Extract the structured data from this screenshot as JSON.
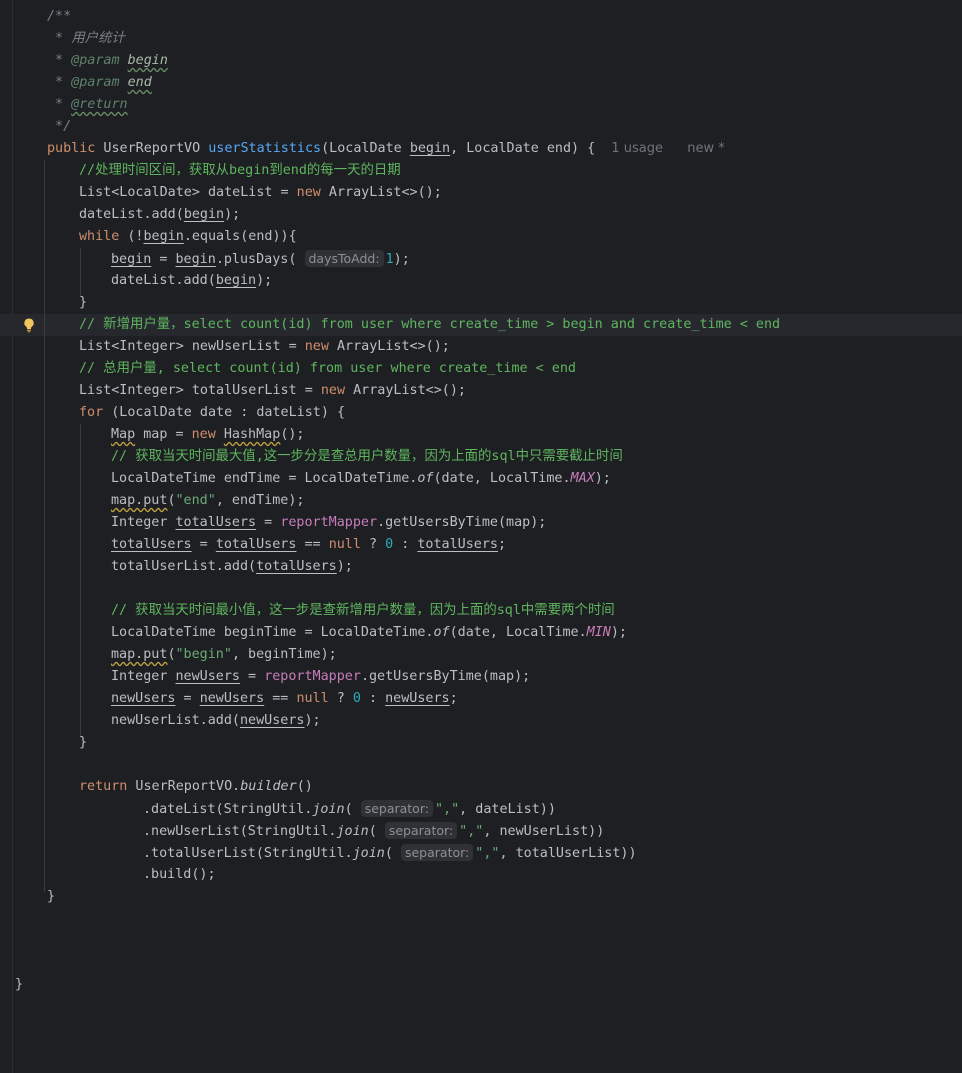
{
  "editor": {
    "doc": {
      "open": "/**",
      "desc_prefix": " * ",
      "desc": "用户统计",
      "param_tag": "@param",
      "param1": "begin",
      "param2": "end",
      "return_tag": "@return",
      "close": " */"
    },
    "sig": {
      "kw_public": "public",
      "ret_type": " UserReportVO ",
      "name": "userStatistics",
      "params_a": "(LocalDate ",
      "p_begin": "begin",
      "params_b": ", LocalDate end) {",
      "usage": "1 usage",
      "new_mark": "new *"
    },
    "c1": "//处理时间区间，获取从begin到end的每一天的日期",
    "c2": "// 新增用户量，select count(id) from user where create_time > begin and create_time < end",
    "c3": "// 总用户量, select count(id) from user where create_time < end",
    "c4": "// 获取当天时间最大值,这一步分是查总用户数量，因为上面的sql中只需要截止时间",
    "c5": "// 获取当天时间最小值，这一步是查新增用户数量，因为上面的sql中需要两个时间",
    "hints": {
      "days_to_add": "daysToAdd:",
      "separator": "separator:"
    },
    "close_brace": "}"
  }
}
